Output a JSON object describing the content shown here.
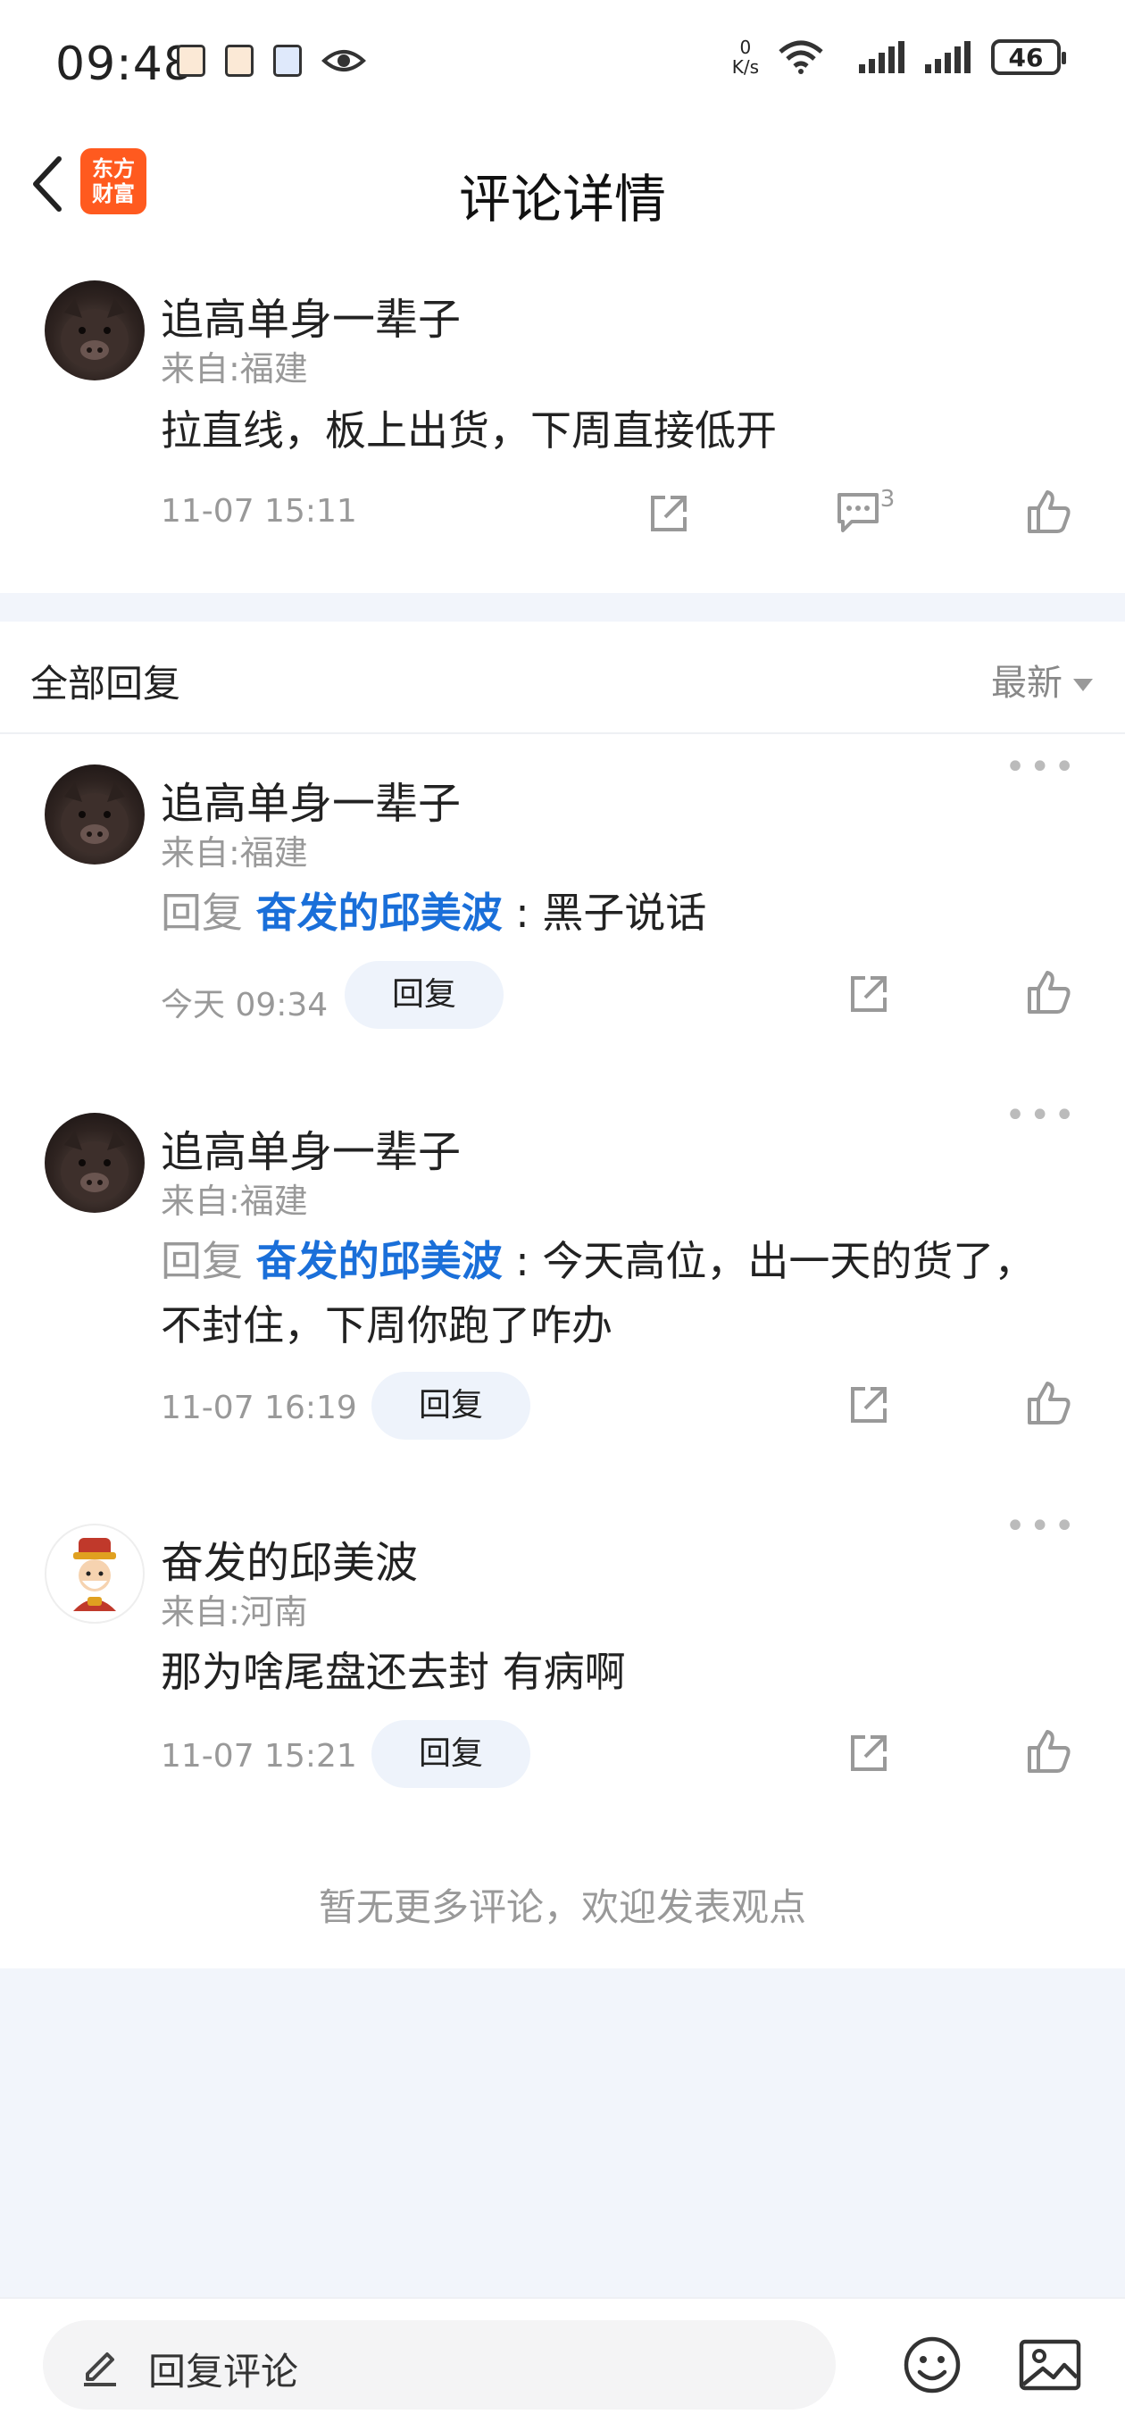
{
  "status_bar": {
    "time": "09:48",
    "net_speed_value": "0",
    "net_speed_unit": "K/s",
    "battery": "46",
    "icons": [
      "app-icon",
      "app-icon",
      "app-icon",
      "eye-icon",
      "wifi-icon",
      "signal-icon",
      "signal-icon",
      "battery-icon"
    ]
  },
  "header": {
    "title": "评论详情",
    "logo_line1": "东方",
    "logo_line2": "财富"
  },
  "main_comment": {
    "user": "追高单身一辈子",
    "location": "来自:福建",
    "text": "拉直线，板上出货，下周直接低开",
    "time": "11-07 15:11",
    "reply_count": "3"
  },
  "replies_header": {
    "title": "全部回复",
    "sort": "最新"
  },
  "replies": [
    {
      "user": "追高单身一辈子",
      "location": "来自:福建",
      "reply_prefix": "回复",
      "mention": "奋发的邱美波",
      "text": " : 黑子说话",
      "time": "今天 09:34",
      "reply_label": "回复"
    },
    {
      "user": "追高单身一辈子",
      "location": "来自:福建",
      "reply_prefix": "回复",
      "mention": "奋发的邱美波",
      "text": " : 今天高位，出一天的货了，不封住，下周你跑了咋办",
      "time": "11-07 16:19",
      "reply_label": "回复"
    },
    {
      "user": "奋发的邱美波",
      "location": "来自:河南",
      "text": "那为啥尾盘还去封 有病啊",
      "time": "11-07 15:21",
      "reply_label": "回复"
    }
  ],
  "end_note": "暂无更多评论，欢迎发表观点",
  "bottom_bar": {
    "placeholder": "回复评论"
  }
}
